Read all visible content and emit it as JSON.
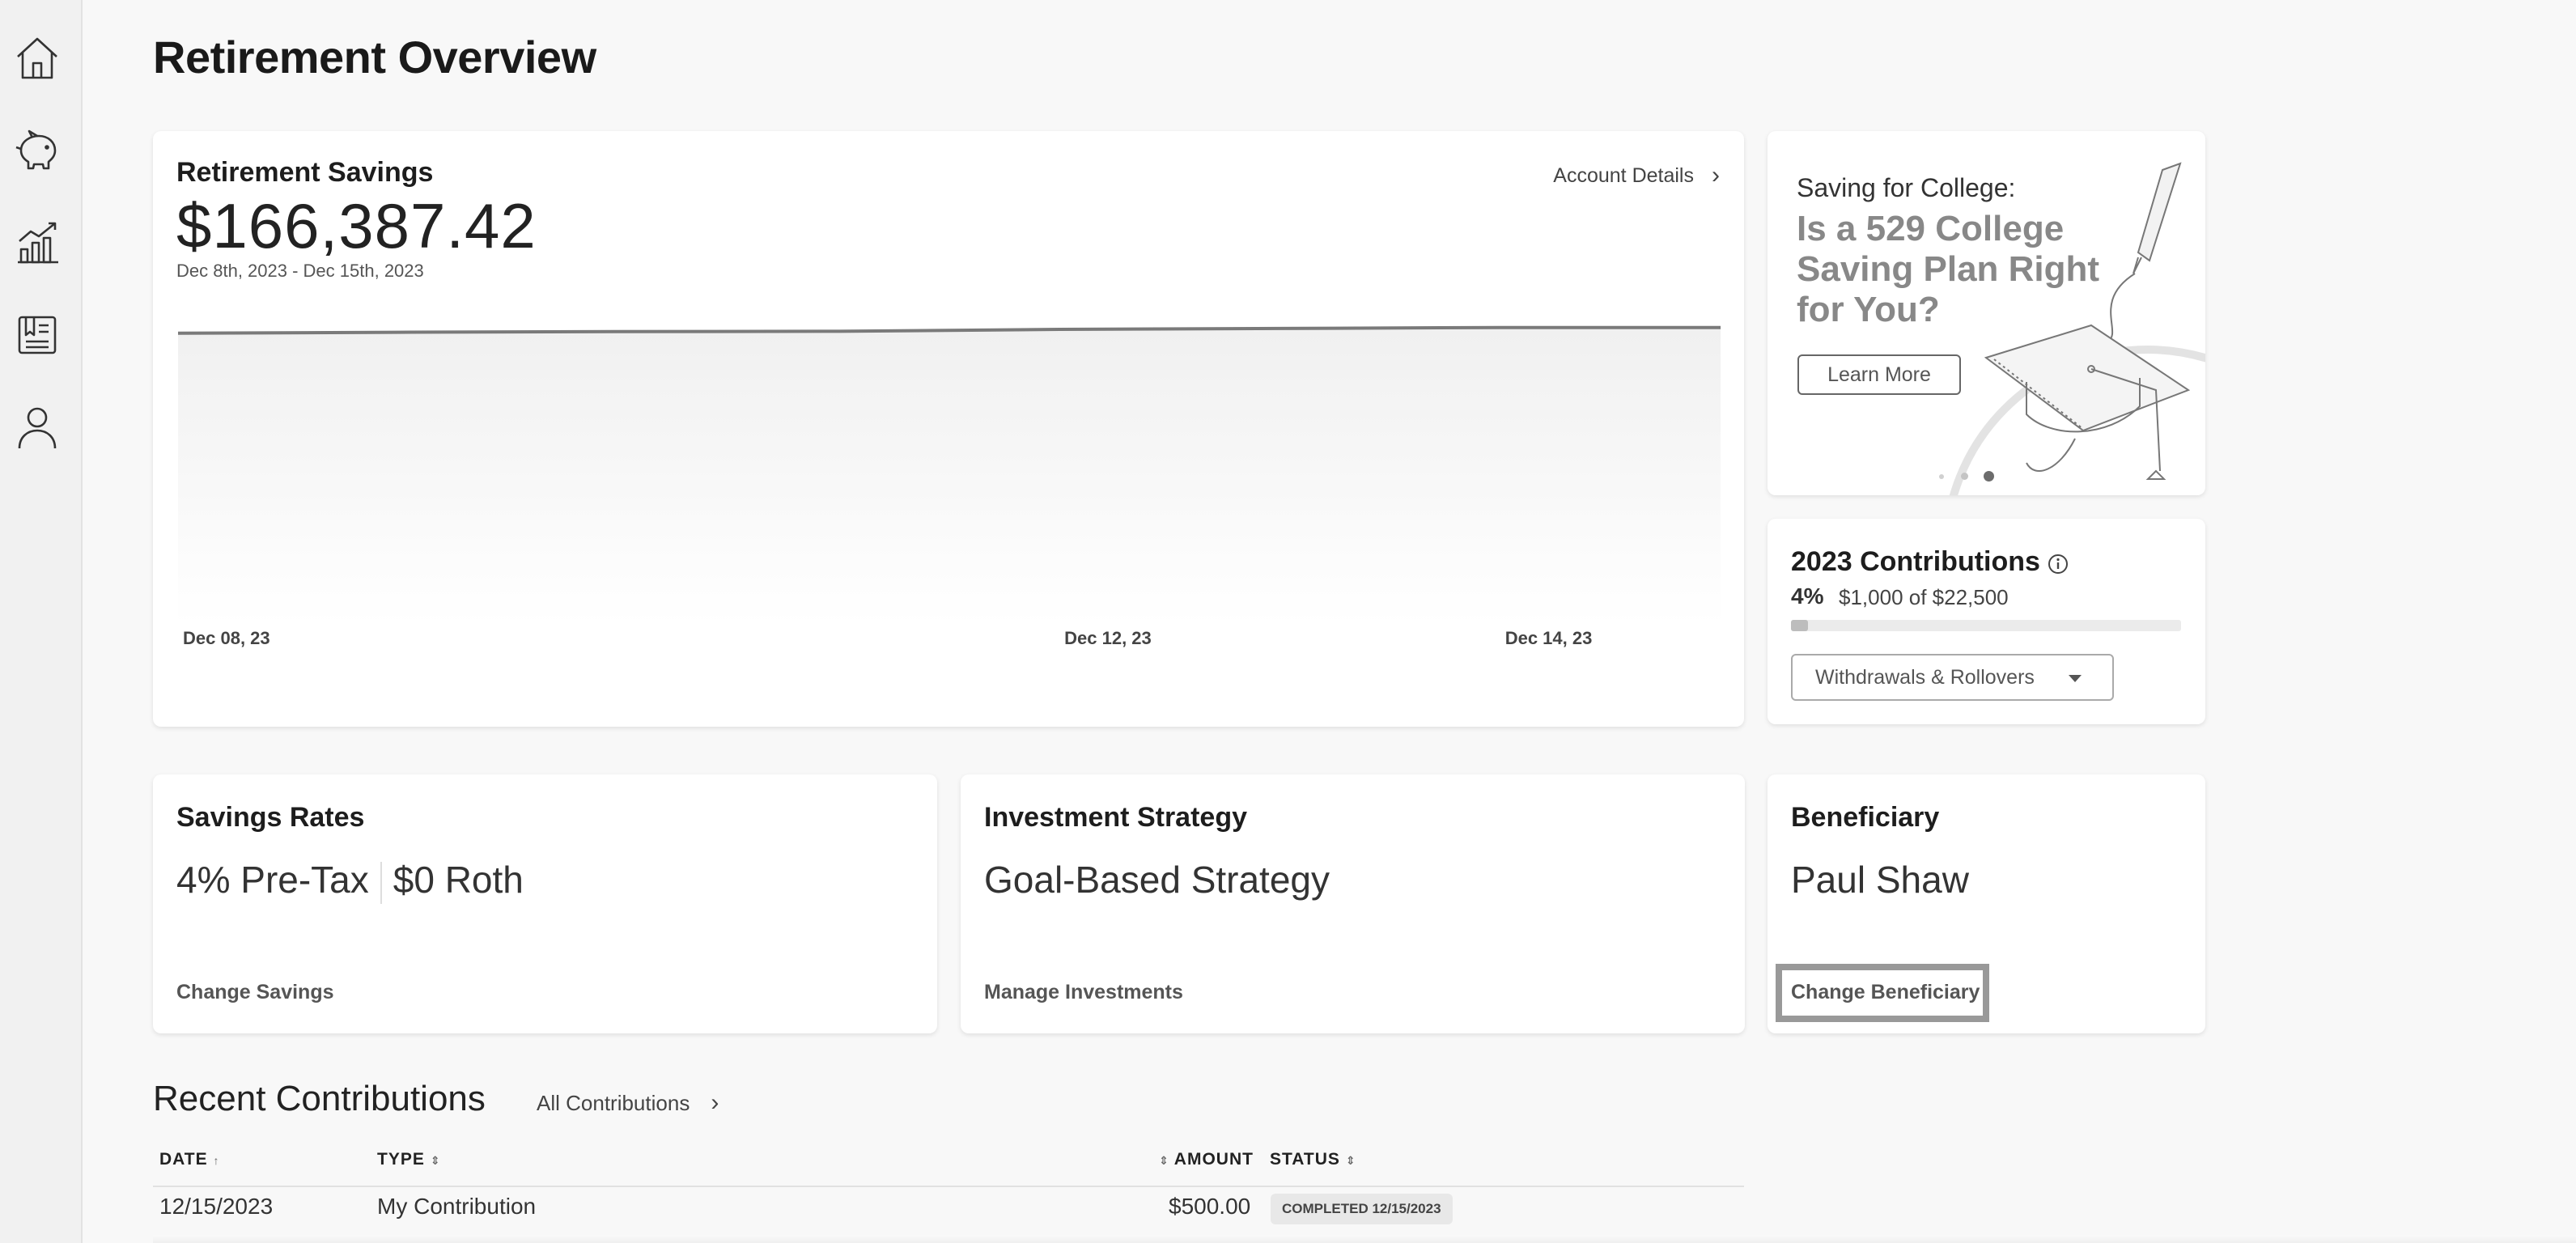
{
  "page": {
    "title": "Retirement Overview"
  },
  "sidebar": {
    "items": [
      {
        "icon": "home-icon"
      },
      {
        "icon": "piggy-bank-icon"
      },
      {
        "icon": "chart-growth-icon"
      },
      {
        "icon": "document-icon"
      },
      {
        "icon": "user-icon"
      }
    ]
  },
  "savings": {
    "title": "Retirement Savings",
    "amount": "$166,387.42",
    "date_range": "Dec 8th, 2023 - Dec 15th, 2023",
    "account_link": "Account Details"
  },
  "chart_data": {
    "type": "area",
    "title": "",
    "x_tick_labels": [
      "Dec 08, 23",
      "Dec 12, 23",
      "Dec 14, 23"
    ],
    "x": [
      "Dec 08, 23",
      "Dec 09, 23",
      "Dec 10, 23",
      "Dec 11, 23",
      "Dec 12, 23",
      "Dec 13, 23",
      "Dec 14, 23",
      "Dec 15, 23"
    ],
    "values": [
      165500,
      165650,
      165750,
      165800,
      166100,
      166250,
      166400,
      166387.42
    ],
    "ylim": [
      120000,
      168000
    ],
    "grid": false
  },
  "promo": {
    "kicker": "Saving for College:",
    "headline": "Is a 529 College Saving Plan Right for You?",
    "button": "Learn More",
    "slides": 3,
    "active_slide": 3
  },
  "contributions": {
    "title": "2023 Contributions",
    "percent": "4%",
    "progress_text": "$1,000 of $22,500",
    "progress_fraction": 0.044,
    "dropdown": "Withdrawals & Rollovers"
  },
  "rates": {
    "title": "Savings Rates",
    "pretax": "4% Pre-Tax",
    "roth": "$0 Roth",
    "link": "Change Savings"
  },
  "strategy": {
    "title": "Investment Strategy",
    "value": "Goal-Based Strategy",
    "link": "Manage Investments"
  },
  "beneficiary": {
    "title": "Beneficiary",
    "name": "Paul Shaw",
    "link": "Change Beneficiary"
  },
  "recent": {
    "title": "Recent Contributions",
    "link": "All Contributions",
    "columns": {
      "date": "DATE",
      "type": "TYPE",
      "amount": "AMOUNT",
      "status": "STATUS"
    },
    "rows": [
      {
        "date": "12/15/2023",
        "type": "My Contribution",
        "amount": "$500.00",
        "status": "COMPLETED 12/15/2023"
      }
    ]
  },
  "colors": {
    "accent": "#888888",
    "line": "#7a7a7a",
    "background": "#f8f8f8"
  }
}
